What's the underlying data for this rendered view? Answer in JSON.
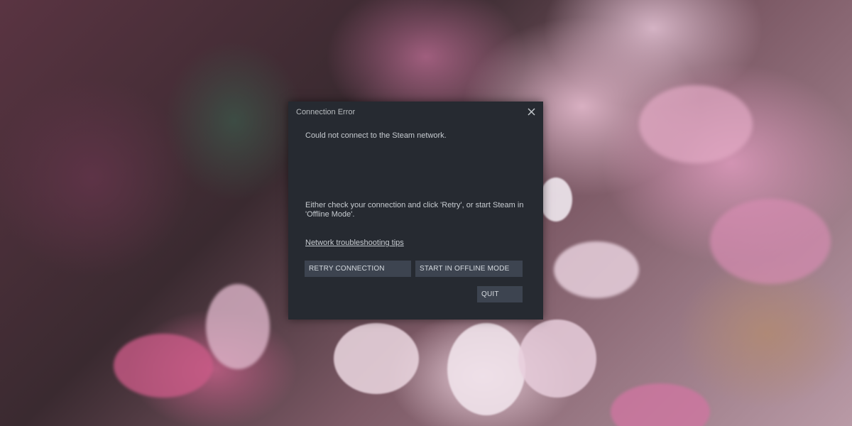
{
  "dialog": {
    "title": "Connection Error",
    "close_icon": "close-icon",
    "message": "Could not connect to the Steam network.",
    "instructions": "Either check your connection and click 'Retry', or start Steam in 'Offline Mode'.",
    "link_label": "Network troubleshooting tips",
    "retry_label": "RETRY CONNECTION",
    "offline_label": "START IN OFFLINE MODE",
    "quit_label": "QUIT"
  },
  "colors": {
    "dialog_bg": "#262a31",
    "button_bg": "#3d4450",
    "text": "#c6cbd0"
  }
}
